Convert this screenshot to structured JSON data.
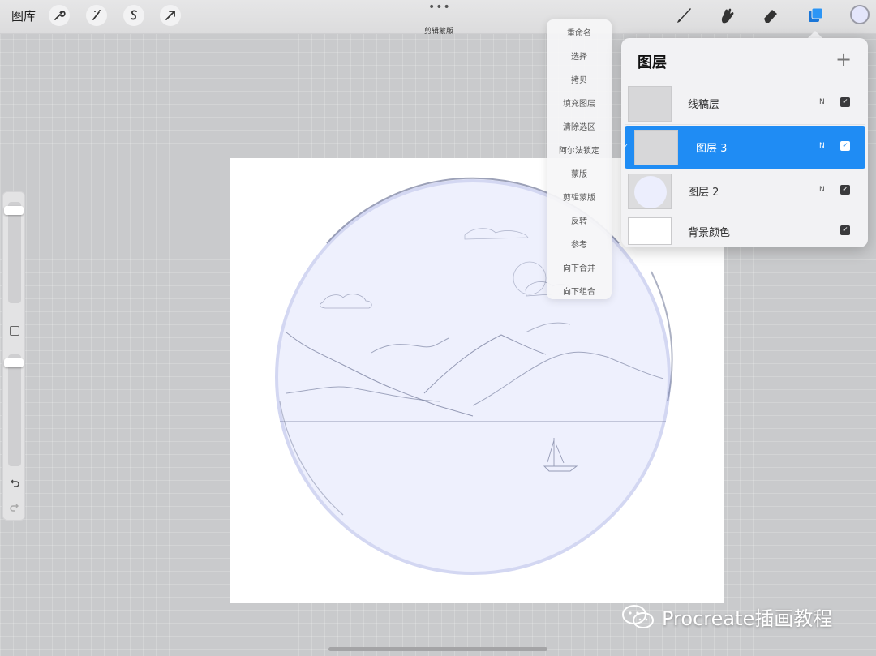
{
  "toolbar": {
    "gallery_label": "图库",
    "status_text": "剪辑蒙版",
    "more_dots": "•••",
    "left_icons": [
      "wrench-icon",
      "magic-wand-icon",
      "selection-s-icon",
      "transform-arrow-icon"
    ],
    "right_icons": [
      "brush-icon",
      "smudge-icon",
      "eraser-icon",
      "layers-icon"
    ],
    "current_color": "#e4e6fb"
  },
  "layer_menu": {
    "items": [
      "重命名",
      "选择",
      "拷贝",
      "填充图层",
      "清除选区",
      "阿尔法锁定",
      "蒙版",
      "剪辑蒙版",
      "反转",
      "参考",
      "向下合并",
      "向下组合"
    ]
  },
  "layers_panel": {
    "title": "图层",
    "add_symbol": "+",
    "layers": [
      {
        "name": "线稿层",
        "blend": "N",
        "visible": true,
        "active": false
      },
      {
        "name": "图层 3",
        "blend": "N",
        "visible": true,
        "active": true
      },
      {
        "name": "图层 2",
        "blend": "N",
        "visible": true,
        "active": false
      },
      {
        "name": "背景颜色",
        "blend": "",
        "visible": true,
        "active": false
      }
    ]
  },
  "colors": {
    "accent": "#1f8cf4",
    "circle_fill": "#eef0fd",
    "sketch_line": "#6d7596"
  },
  "watermark": {
    "text": "Procreate插画教程"
  }
}
